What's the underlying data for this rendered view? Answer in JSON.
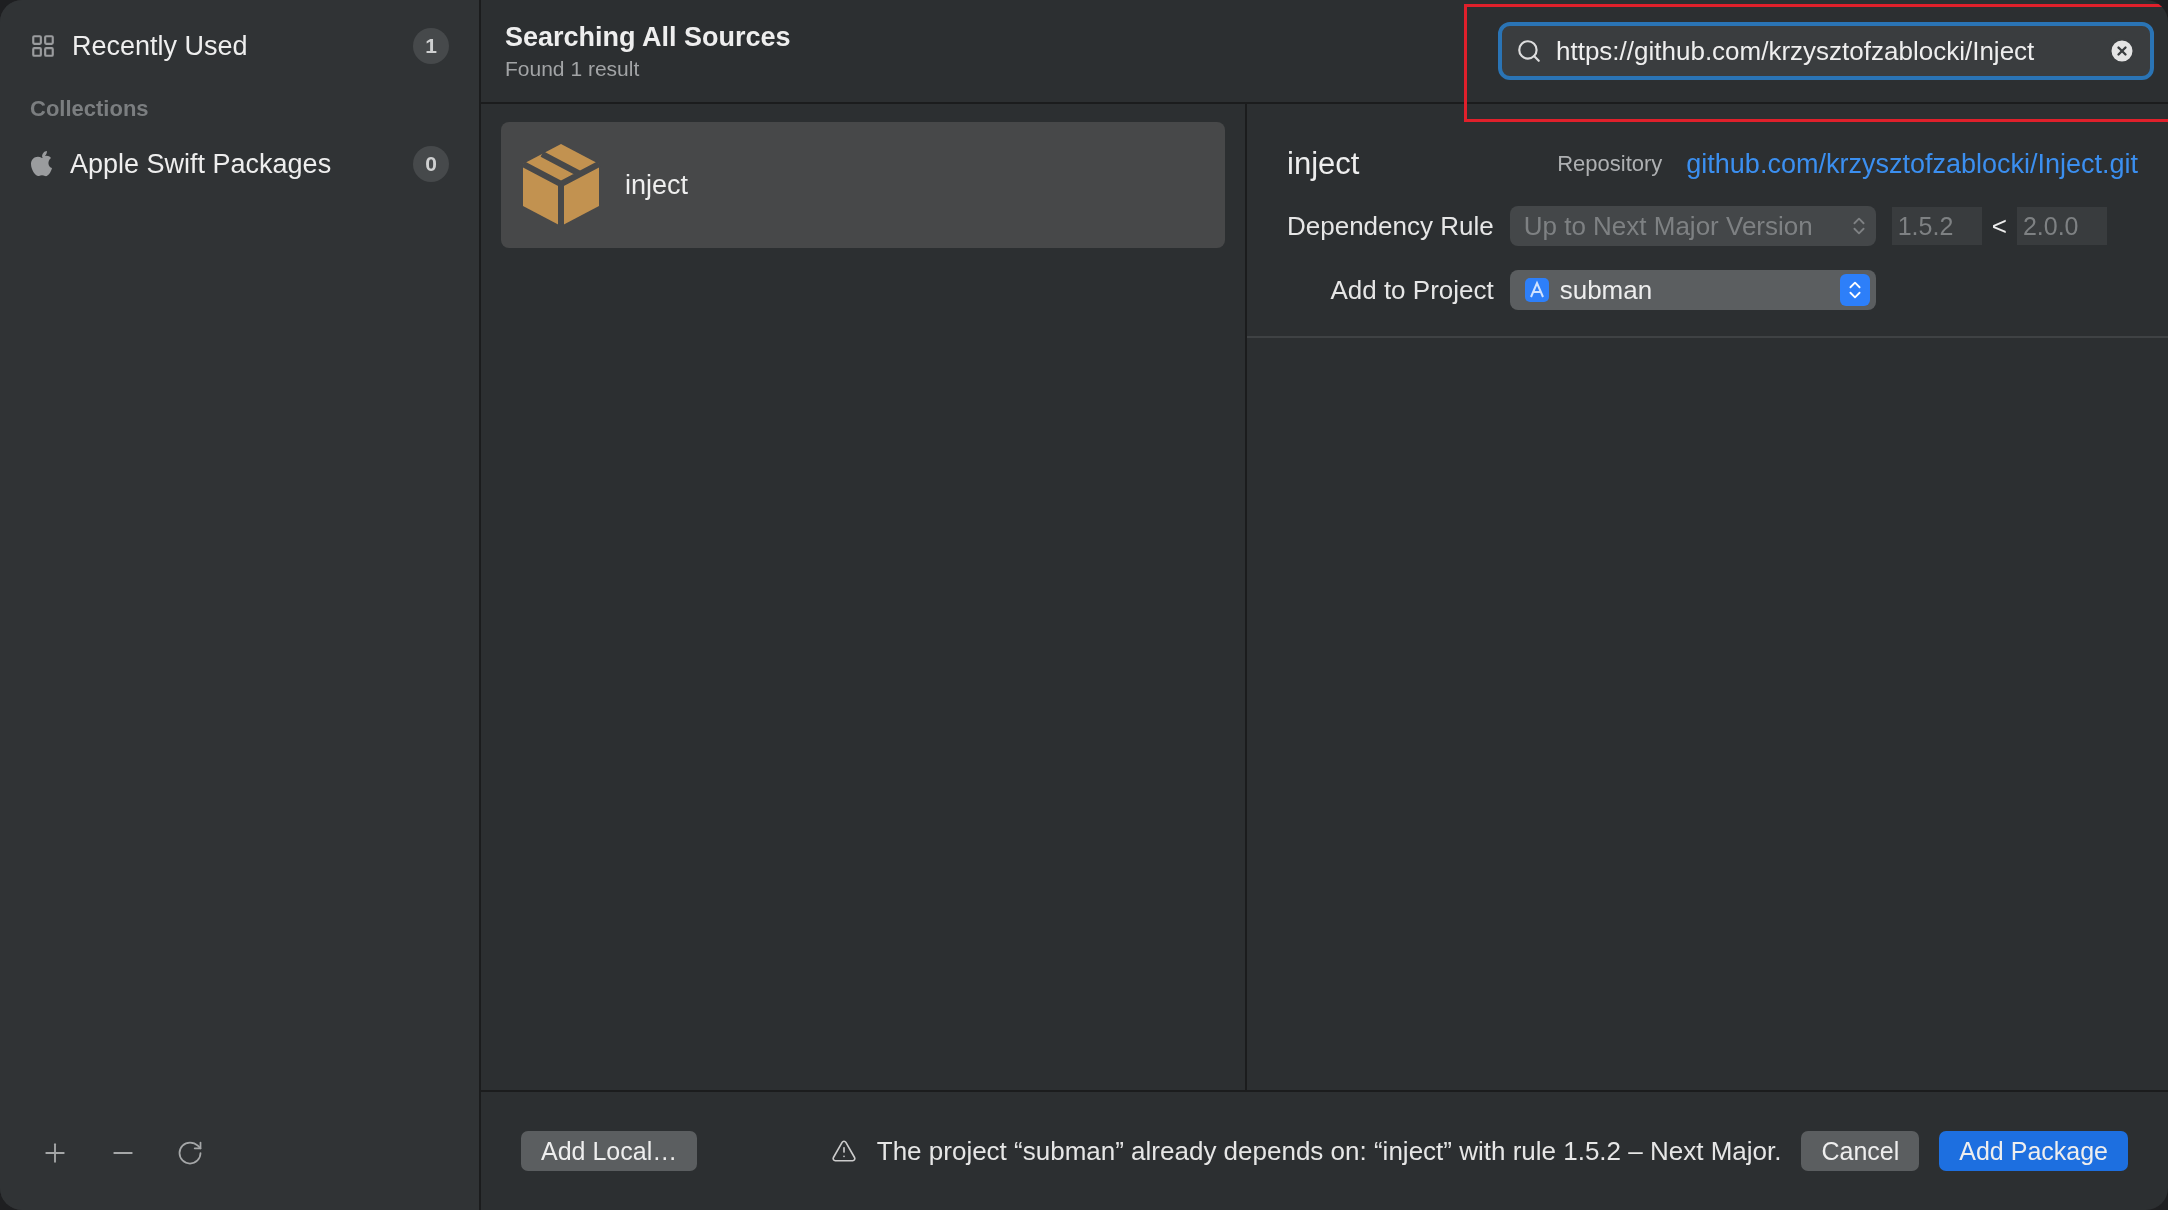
{
  "sidebar": {
    "items": [
      {
        "kind": "recent",
        "label": "Recently Used",
        "count": "1",
        "selected": false
      }
    ],
    "section_title": "Collections",
    "collections": [
      {
        "kind": "apple",
        "label": "Apple Swift Packages",
        "count": "0",
        "selected": false
      }
    ]
  },
  "header": {
    "title": "Searching All Sources",
    "subtitle": "Found 1 result"
  },
  "search": {
    "value": "https://github.com/krzysztofzablocki/Inject",
    "highlighted": true
  },
  "results": [
    {
      "name": "inject",
      "selected": true
    }
  ],
  "detail": {
    "name": "inject",
    "repository_label": "Repository",
    "repository_link": "github.com/krzysztofzablocki/Inject.git",
    "dependency_rule_label": "Dependency Rule",
    "dependency_rule": {
      "value": "Up to Next Major Version",
      "disabled": true
    },
    "version_from": "1.5.2",
    "version_separator": "<",
    "version_to": "2.0.0",
    "add_to_project_label": "Add to Project",
    "project": "subman"
  },
  "footer": {
    "add_local": "Add Local…",
    "warning": "The project “subman” already depends on: “inject” with rule 1.5.2 – Next Major.",
    "cancel": "Cancel",
    "add_package": "Add Package"
  }
}
